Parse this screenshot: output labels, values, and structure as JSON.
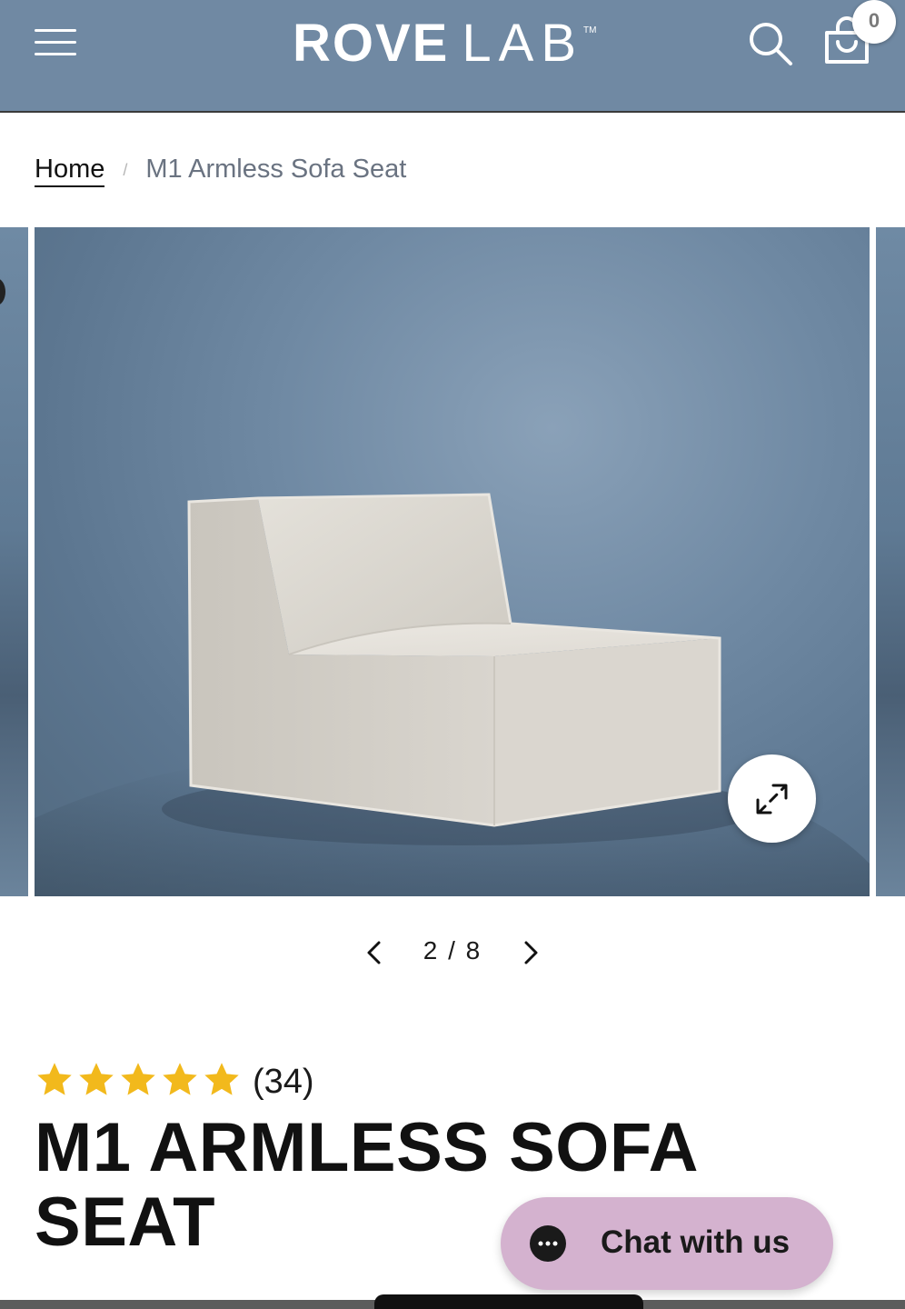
{
  "header": {
    "logo_primary": "ROVE",
    "logo_secondary": "LAB",
    "logo_tm": "TM",
    "cart_count": "0",
    "icons": {
      "menu": "hamburger-menu-icon",
      "search": "search-icon",
      "cart": "shopping-bag-icon"
    },
    "background_color": "#7089a3"
  },
  "breadcrumb": {
    "home_label": "Home",
    "separator": "/",
    "current_label": "M1 Armless Sofa Seat"
  },
  "gallery": {
    "current_slide": 2,
    "total_slides": 8,
    "counter_current": "2",
    "counter_separator": "/",
    "counter_total": "8",
    "image_subject": "armless-sofa-seat-product-photo",
    "icons": {
      "zoom": "expand-arrows-icon",
      "prev": "chevron-left-icon",
      "next": "chevron-right-icon"
    }
  },
  "product": {
    "rating_stars": 5,
    "review_count": "(34)",
    "title": "M1 ARMLESS SOFA SEAT",
    "star_color": "#f2b91c"
  },
  "chat": {
    "label": "Chat with us",
    "icon": "chat-bubble-ellipsis-icon",
    "background_color": "#d4b2cf"
  }
}
